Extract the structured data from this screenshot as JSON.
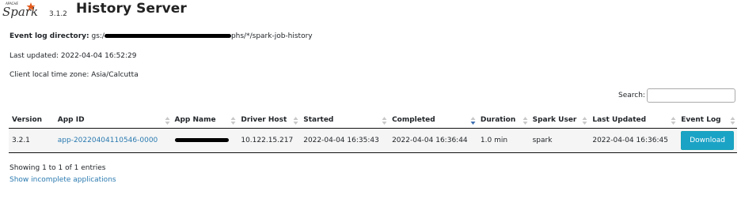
{
  "header": {
    "logo_text": "Spark",
    "logo_super": "APACHE",
    "version": "3.1.2",
    "title": "History Server"
  },
  "info": {
    "event_log_label": "Event log directory:",
    "event_log_prefix": "gs:/",
    "event_log_suffix": "phs/*/spark-job-history",
    "last_updated": "Last updated: 2022-04-04 16:52:29",
    "time_zone": "Client local time zone: Asia/Calcutta"
  },
  "search": {
    "label": "Search:",
    "value": ""
  },
  "table": {
    "columns": [
      "Version",
      "App ID",
      "App Name",
      "Driver Host",
      "Started",
      "Completed",
      "Duration",
      "Spark User",
      "Last Updated",
      "Event Log"
    ],
    "rows": [
      {
        "version": "3.2.1",
        "app_id": "app-20220404110546-0000",
        "app_name": "",
        "driver_host": "10.122.15.217",
        "started": "2022-04-04 16:35:43",
        "completed": "2022-04-04 16:36:44",
        "duration": "1.0 min",
        "spark_user": "spark",
        "last_updated": "2022-04-04 16:36:45",
        "event_log": "Download"
      }
    ],
    "sorted_column": "Completed",
    "sort_direction": "descending"
  },
  "footer": {
    "showing": "Showing 1 to 1 of 1 entries",
    "incomplete_link": "Show incomplete applications"
  },
  "colors": {
    "link": "#2a7ab0",
    "download_button": "#1ba3c6",
    "logo_star": "#e25a1c"
  }
}
